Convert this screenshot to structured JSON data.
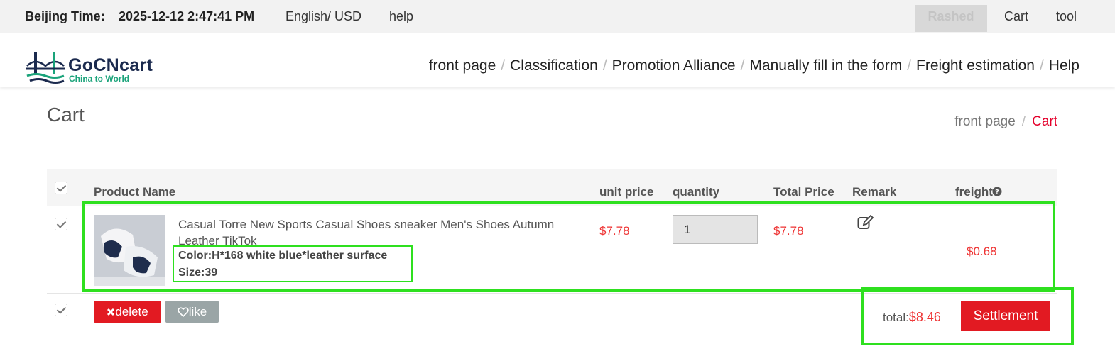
{
  "topbar": {
    "time_label": "Beijing Time:",
    "time_value": "2025-12-12 2:47:41 PM",
    "language": "English/ USD",
    "help": "help",
    "user": "Rashed",
    "cart": "Cart",
    "tool": "tool"
  },
  "brand": {
    "name": "GoCNcart",
    "tagline": "China to World"
  },
  "nav": {
    "items": [
      "front page",
      "Classification",
      "Promotion Alliance",
      "Manually fill in the form",
      "Freight estimation",
      "Help"
    ],
    "separator": "/"
  },
  "page": {
    "title": "Cart",
    "breadcrumb": [
      "front page",
      "Cart"
    ]
  },
  "table": {
    "headers": {
      "product": "Product Name",
      "unit_price": "unit price",
      "quantity": "quantity",
      "total_price": "Total Price",
      "remark": "Remark",
      "freight": "freight"
    },
    "rows": [
      {
        "title": "Casual Torre New Sports Casual Shoes sneaker Men's Shoes Autumn Leather TikTok",
        "color": "Color:H*168 white blue*leather surface",
        "size": "Size:39",
        "unit_price": "$7.78",
        "quantity": "1",
        "total_price": "$7.78",
        "freight": "$0.68",
        "checked": true
      }
    ]
  },
  "footer": {
    "delete_label": "delete",
    "like_label": "like",
    "total_label": "total:",
    "total_value": "$8.46",
    "settle_label": "Settlement"
  },
  "icons": {
    "delete": "x-icon",
    "like": "heart-icon",
    "freight_help": "question-circle-icon",
    "remark": "edit-icon"
  },
  "colors": {
    "accent_red": "#e21a22",
    "price_red": "#e33333",
    "highlight_green": "#2ee01f",
    "brand_navy": "#1b2a4e",
    "brand_teal": "#1aa37a"
  }
}
